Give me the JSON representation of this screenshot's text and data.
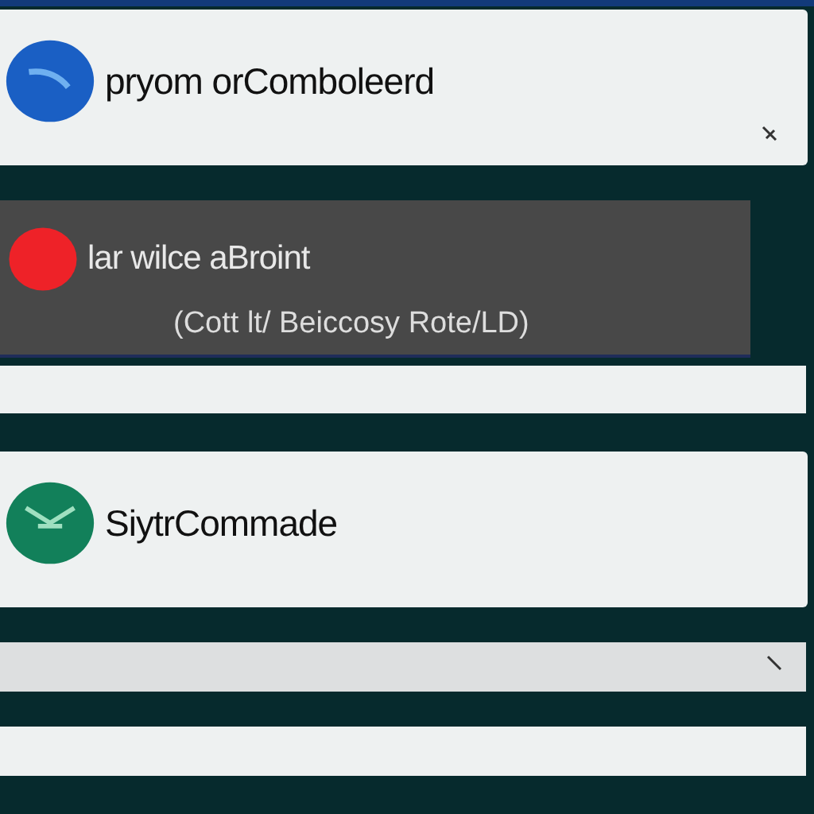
{
  "cards": [
    {
      "kind": "light",
      "color": "#1a5fc4",
      "title": "pryom orComboleerd",
      "corner_mark": true
    },
    {
      "kind": "dark",
      "color": "#ee2228",
      "title": "lar wilce aBroint",
      "subtitle": "(Cott lt/ Beiccosy Rote/LD)"
    },
    {
      "kind": "bar",
      "corner_mark": false
    },
    {
      "kind": "light",
      "color": "#12805a",
      "title": "SiytrCommade",
      "corner_mark": false
    },
    {
      "kind": "grey",
      "corner_mark": true
    },
    {
      "kind": "bar",
      "corner_mark": false
    }
  ]
}
